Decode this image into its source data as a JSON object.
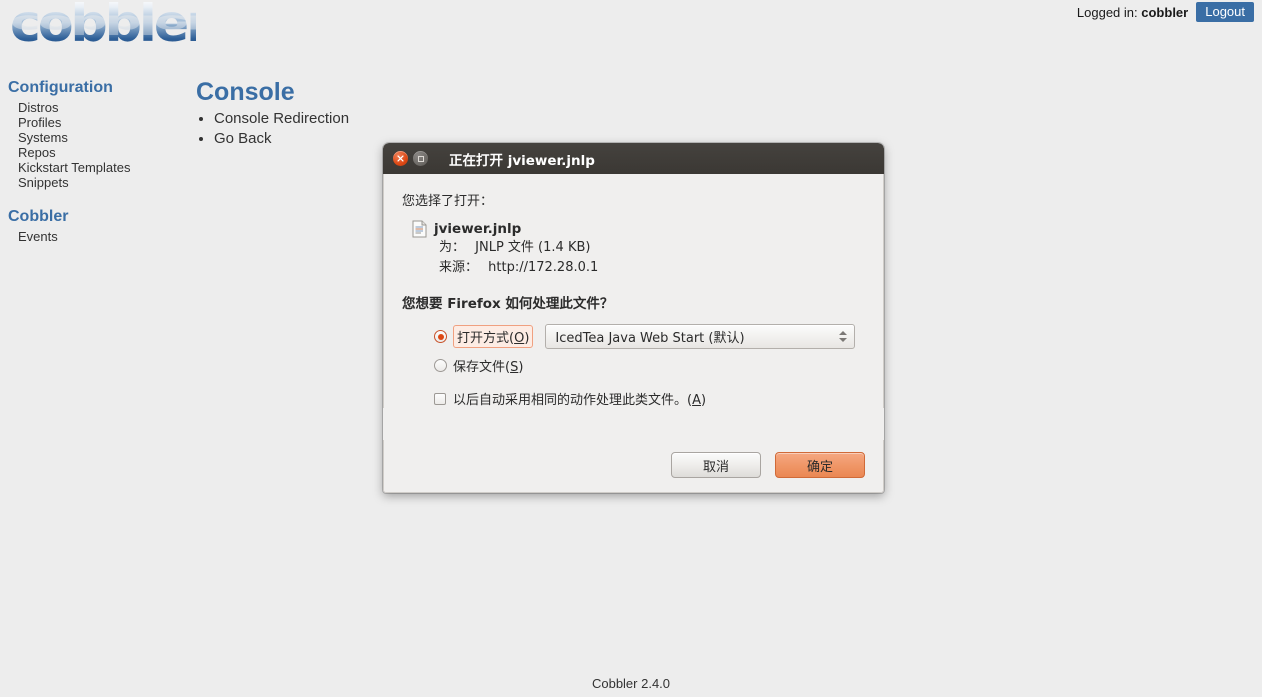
{
  "header": {
    "logo_text": "cobbler",
    "logged_in_label": "Logged in:",
    "username": "cobbler",
    "logout_label": "Logout"
  },
  "sidebar": {
    "sections": [
      {
        "title": "Configuration",
        "items": [
          "Distros",
          "Profiles",
          "Systems",
          "Repos",
          "Kickstart Templates",
          "Snippets"
        ]
      },
      {
        "title": "Cobbler",
        "items": [
          "Events"
        ]
      }
    ]
  },
  "main": {
    "title": "Console",
    "links": [
      "Console Redirection",
      "Go Back"
    ]
  },
  "footer": {
    "text": "Cobbler 2.4.0"
  },
  "dialog": {
    "title": "正在打开 jviewer.jnlp",
    "intro": "您选择了打开：",
    "file_name": "jviewer.jnlp",
    "type_label": "为：",
    "type_value": "JNLP 文件 (1.4 KB)",
    "source_label": "来源：",
    "source_value": "http://172.28.0.1",
    "question": "您想要 Firefox 如何处理此文件？",
    "open_with_label": "打开方式(O)",
    "open_with_accel": "O",
    "open_with_prefix": "打开方式(",
    "open_with_suffix": ")",
    "combo_value": "IcedTea Java Web Start (默认)",
    "save_label_prefix": "保存文件(",
    "save_accel": "S",
    "save_label_suffix": ")",
    "remember_prefix": "以后自动采用相同的动作处理此类文件。(",
    "remember_accel": "A",
    "remember_suffix": ")",
    "cancel_label": "取消",
    "ok_label": "确定",
    "accent_color": "#dd4814",
    "titlebar_color": "#3b3834"
  }
}
